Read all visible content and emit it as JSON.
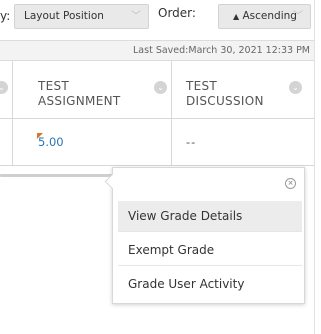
{
  "sort_bar": {
    "by_label_partial": "y:",
    "by_value": "Layout Position",
    "order_label": "Order:",
    "order_value": "Ascending",
    "order_icon": "▲"
  },
  "status": {
    "last_saved": "Last Saved:March 30, 2021 12:33 PM"
  },
  "grid": {
    "columns": [
      {
        "title": "TEST ASSIGNMENT"
      },
      {
        "title": "TEST DISCUSSION"
      }
    ],
    "row": {
      "assignment_grade": "5.00",
      "discussion_grade": "--"
    }
  },
  "context_menu": {
    "items": [
      {
        "label": "View Grade Details"
      },
      {
        "label": "Exempt Grade"
      },
      {
        "label": "Grade User Activity"
      }
    ],
    "close_icon": "close-circle-icon"
  },
  "colors": {
    "grade_link": "#2c74b5",
    "needs_grading_flag": "#d9752b"
  }
}
